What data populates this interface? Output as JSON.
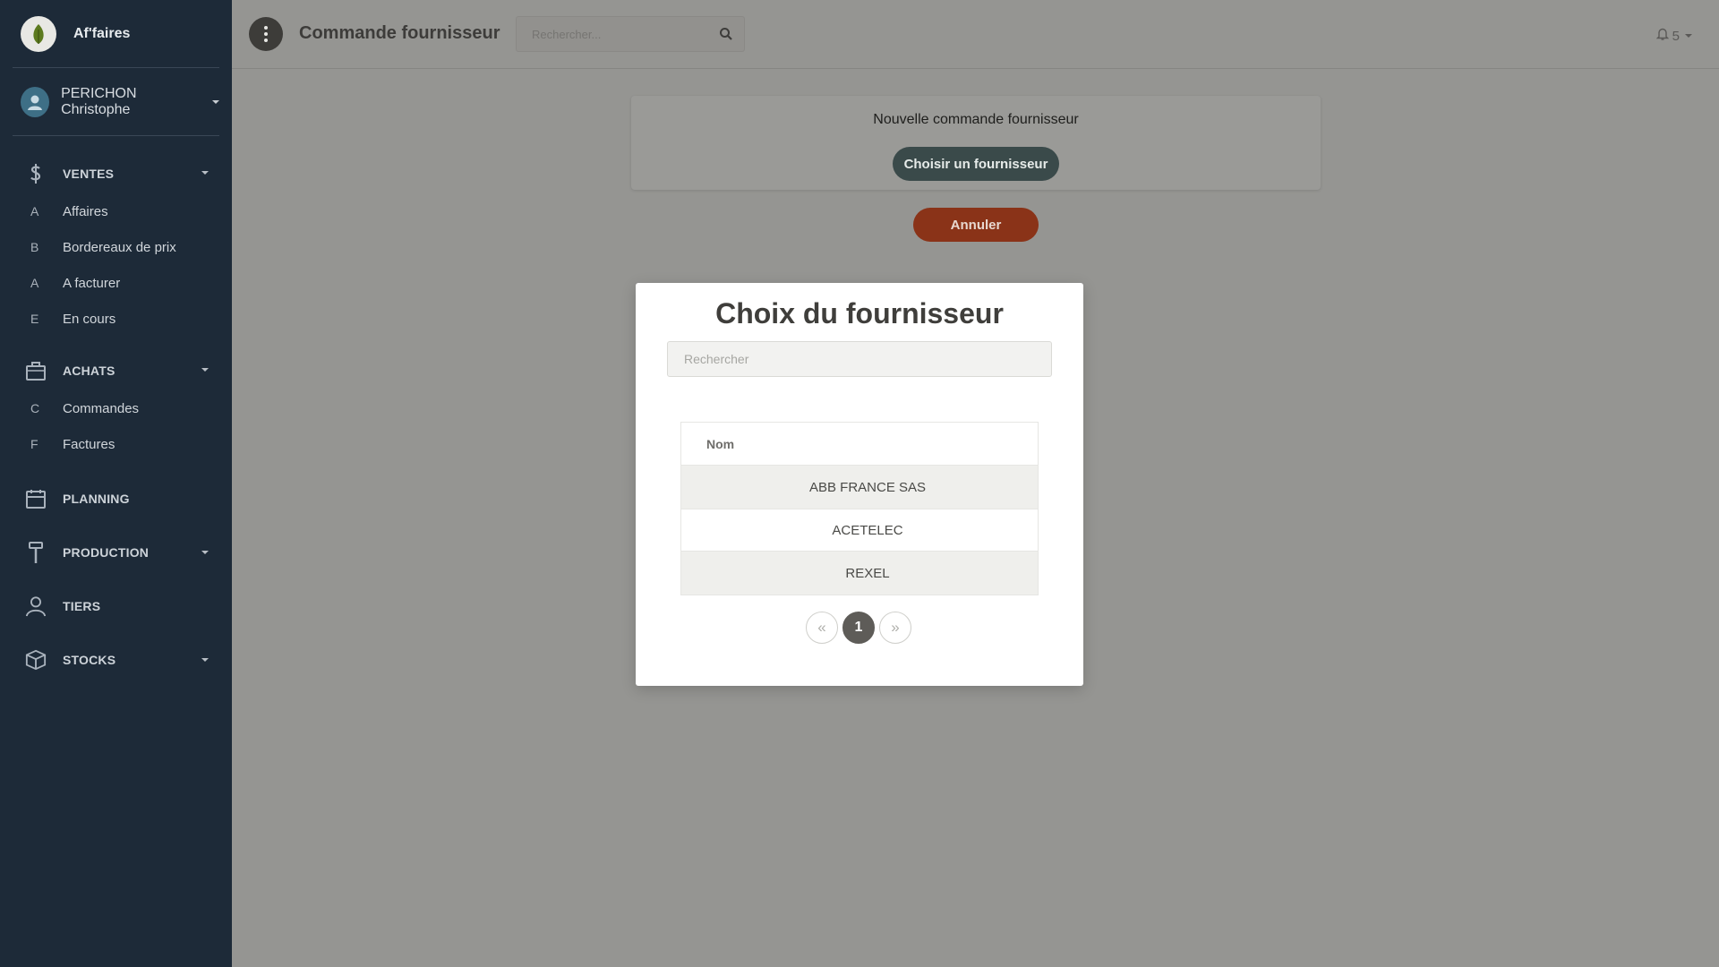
{
  "sidebar": {
    "brand": "Af'faires",
    "user_name": "PERICHON Christophe",
    "sections": [
      {
        "label": "VENTES",
        "icon": "dollar-icon",
        "items": [
          {
            "letter": "A",
            "label": "Affaires"
          },
          {
            "letter": "B",
            "label": "Bordereaux de prix"
          },
          {
            "letter": "A",
            "label": "A facturer"
          },
          {
            "letter": "E",
            "label": "En cours"
          }
        ]
      },
      {
        "label": "ACHATS",
        "icon": "basket-icon",
        "items": [
          {
            "letter": "C",
            "label": "Commandes"
          },
          {
            "letter": "F",
            "label": "Factures"
          }
        ]
      },
      {
        "label": "PLANNING",
        "icon": "calendar-icon"
      },
      {
        "label": "PRODUCTION",
        "icon": "hammer-icon"
      },
      {
        "label": "TIERS",
        "icon": "person-icon"
      },
      {
        "label": "STOCKS",
        "icon": "box-icon"
      }
    ]
  },
  "header": {
    "title": "Commande fournisseur",
    "search_placeholder": "Rechercher...",
    "notifications_count": "5"
  },
  "card": {
    "title": "Nouvelle commande fournisseur",
    "choose_label": "Choisir un fournisseur",
    "cancel_label": "Annuler"
  },
  "modal": {
    "title": "Choix du fournisseur",
    "search_placeholder": "Rechercher",
    "column_header": "Nom",
    "rows": [
      "ABB FRANCE SAS",
      "ACETELEC",
      "REXEL"
    ],
    "pagination": {
      "prev": "«",
      "current": "1",
      "next": "»"
    }
  },
  "colors": {
    "sidebar_bg": "#1d2a38",
    "primary_button": "#3a4a4a",
    "cancel_button": "#8a3318",
    "overlay": "#959592"
  }
}
